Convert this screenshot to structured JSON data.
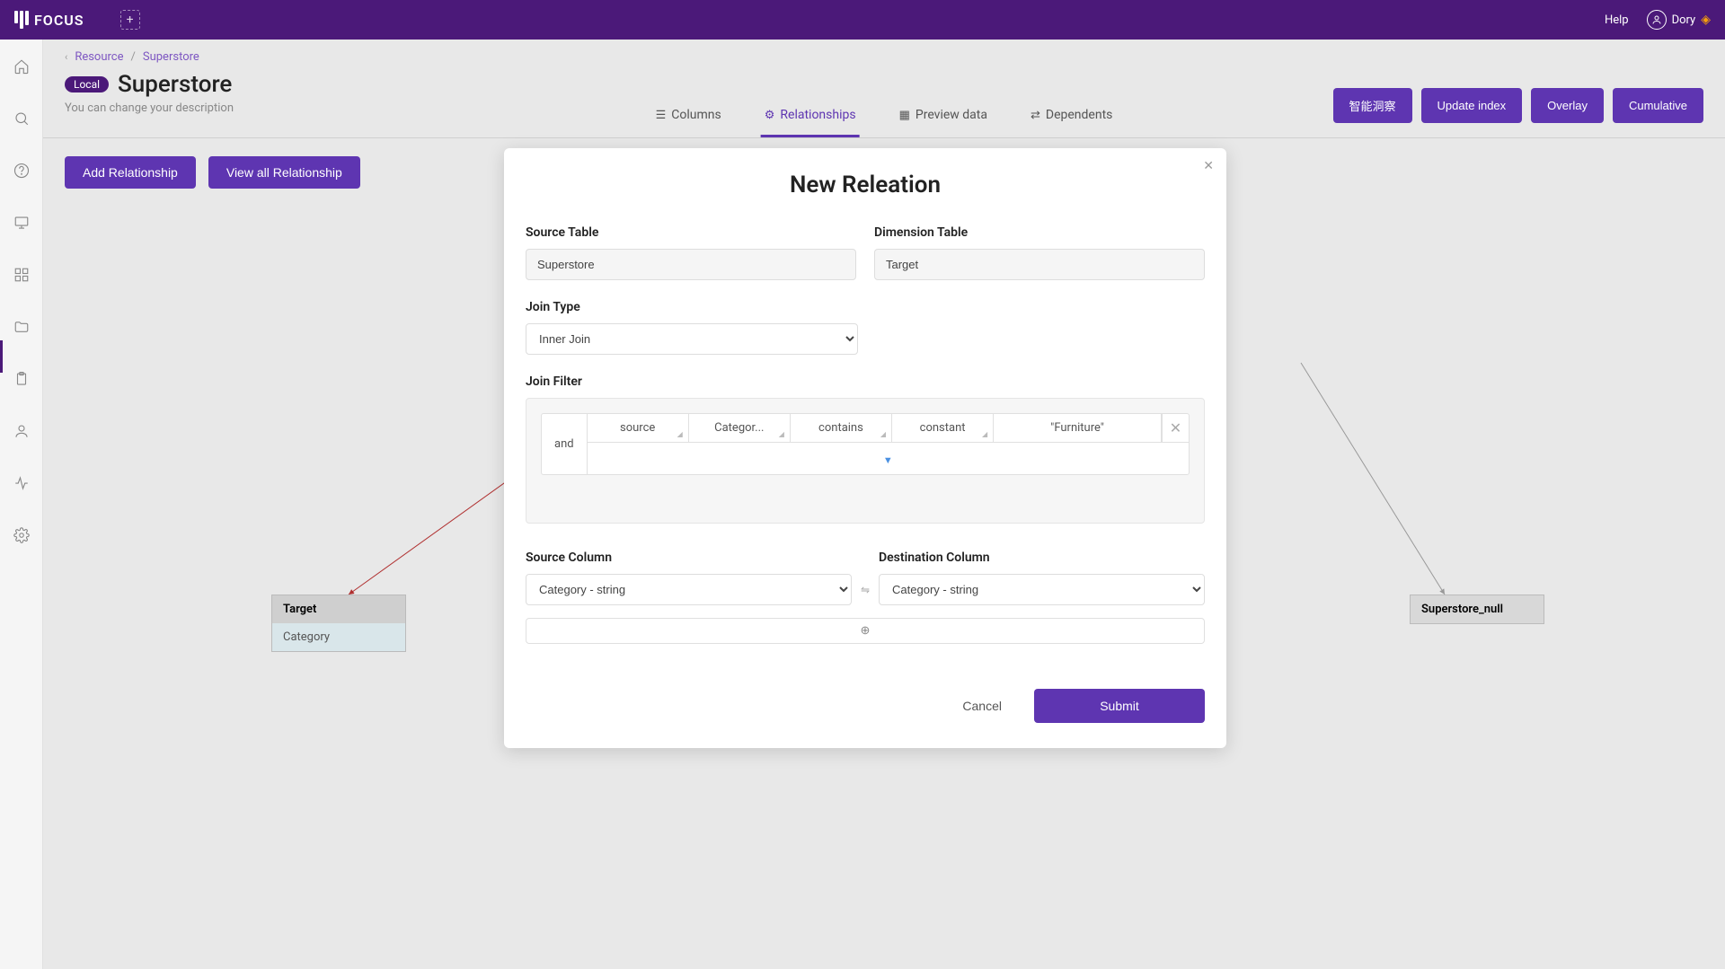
{
  "header": {
    "app_name": "FOCUS",
    "help_label": "Help",
    "user_name": "Dory"
  },
  "breadcrumb": {
    "item1": "Resource",
    "item2": "Superstore"
  },
  "page": {
    "badge": "Local",
    "title": "Superstore",
    "subtitle": "You can change your description"
  },
  "tabs": {
    "columns": "Columns",
    "relationships": "Relationships",
    "preview": "Preview data",
    "dependents": "Dependents"
  },
  "headerActions": {
    "insight": "智能洞察",
    "update": "Update index",
    "overlay": "Overlay",
    "cumulative": "Cumulative"
  },
  "toolbar": {
    "add": "Add Relationship",
    "viewAll": "View all Relationship"
  },
  "nodes": {
    "target": {
      "title": "Target",
      "row1": "Category"
    },
    "super": {
      "title": "Superstore_null"
    }
  },
  "modal": {
    "title": "New Releation",
    "labels": {
      "sourceTable": "Source Table",
      "dimensionTable": "Dimension Table",
      "joinType": "Join Type",
      "joinFilter": "Join Filter",
      "sourceColumn": "Source Column",
      "destColumn": "Destination Column"
    },
    "values": {
      "sourceTable": "Superstore",
      "dimensionTable": "Target",
      "joinType": "Inner Join",
      "sourceColumn": "Category - string",
      "destColumn": "Category - string"
    },
    "filter": {
      "logic": "and",
      "c1": "source",
      "c2": "Categor...",
      "c3": "contains",
      "c4": "constant",
      "c5": "\"Furniture\""
    },
    "buttons": {
      "cancel": "Cancel",
      "submit": "Submit"
    }
  }
}
